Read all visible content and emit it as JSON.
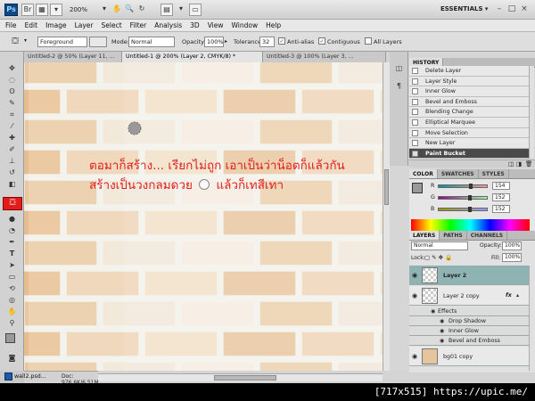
{
  "appbar": {
    "logo": "Ps",
    "zoom": "200%",
    "essentials": "ESSENTIALS ▾",
    "win_min": "–",
    "win_max": "□",
    "win_close": "×"
  },
  "menu": [
    "File",
    "Edit",
    "Image",
    "Layer",
    "Select",
    "Filter",
    "Analysis",
    "3D",
    "View",
    "Window",
    "Help"
  ],
  "options": {
    "fill_source": "Foreground",
    "mode_label": "Mode:",
    "mode_value": "Normal",
    "opacity_label": "Opacity:",
    "opacity_value": "100%",
    "tolerance_label": "Tolerance:",
    "tolerance_value": "32",
    "antialias_label": "Anti-alias",
    "contiguous_label": "Contiguous",
    "all_layers_label": "All Layers"
  },
  "tabs": [
    "Untitled-2 @ 50% (Layer 11, ...",
    "Untitled-1 @ 200% (Layer 2, CMYK/8) *",
    "Untitled-3 @ 100% (Layer 3, ..."
  ],
  "canvas": {
    "line1": "ตอมาก็สร้าง... เรียกไม่ถูก เอาเป็นว่าน็อตก็แล้วกัน",
    "line2_a": "สร้างเป็นวงกลมดวย",
    "line2_b": "แล้วก็เทสีเทา",
    "brick_color": "#e9c8a0",
    "mortar_color": "#f2efe8"
  },
  "status": {
    "filename": "wall2.psd...",
    "doc_info": "Doc: 976.6K/6.51M"
  },
  "history": {
    "tab": "HISTORY",
    "items": [
      "Delete Layer",
      "Layer Style",
      "Inner Glow",
      "Bevel and Emboss",
      "Blending Change",
      "Elliptical Marquee",
      "Move Selection",
      "New Layer",
      "Paint Bucket"
    ]
  },
  "color": {
    "tabs": [
      "COLOR",
      "SWATCHES",
      "STYLES"
    ],
    "r_label": "R",
    "g_label": "G",
    "b_label": "B",
    "r_value": "154",
    "g_value": "152",
    "b_value": "152"
  },
  "layers": {
    "tabs": [
      "LAYERS",
      "PATHS",
      "CHANNELS"
    ],
    "blend_mode": "Normal",
    "opacity_label": "Opacity:",
    "opacity_value": "100%",
    "lock_label": "Lock:",
    "fill_label": "Fill:",
    "fill_value": "100%",
    "items": [
      {
        "name": "Layer 2"
      },
      {
        "name": "Layer 2 copy",
        "fx": "fx"
      },
      {
        "name": "Effects"
      },
      {
        "name": "Drop Shadow"
      },
      {
        "name": "Inner Glow"
      },
      {
        "name": "Bevel and Emboss"
      },
      {
        "name": "bg01 copy"
      }
    ]
  },
  "footer": "[717x515] https://upic.me/"
}
